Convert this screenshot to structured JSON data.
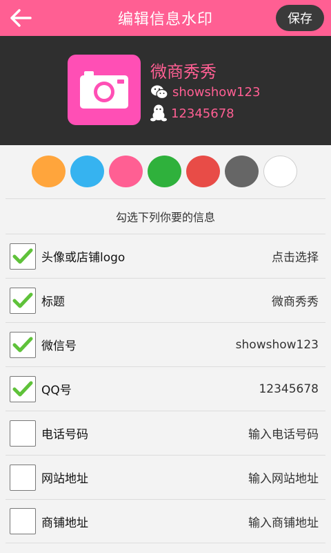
{
  "header": {
    "title": "编辑信息水印",
    "save_label": "保存",
    "back_icon": "arrow-left-icon"
  },
  "preview": {
    "title": "微商秀秀",
    "wechat": "showshow123",
    "qq": "12345678",
    "avatar_icon": "camera-icon",
    "accent": "#ff5f93"
  },
  "colors": [
    "#ffa53c",
    "#36b3f0",
    "#ff5f93",
    "#2fb13c",
    "#e84c47",
    "#666666",
    "#ffffff"
  ],
  "instruction": "勾选下列你要的信息",
  "options": [
    {
      "label": "头像或店铺logo",
      "value": "点击选择",
      "checked": true
    },
    {
      "label": "标题",
      "value": "微商秀秀",
      "checked": true
    },
    {
      "label": "微信号",
      "value": "showshow123",
      "checked": true
    },
    {
      "label": "QQ号",
      "value": "12345678",
      "checked": true
    },
    {
      "label": "电话号码",
      "value": "输入电话号码",
      "checked": false
    },
    {
      "label": "网站地址",
      "value": "输入网站地址",
      "checked": false
    },
    {
      "label": "商铺地址",
      "value": "输入商铺地址",
      "checked": false
    }
  ]
}
